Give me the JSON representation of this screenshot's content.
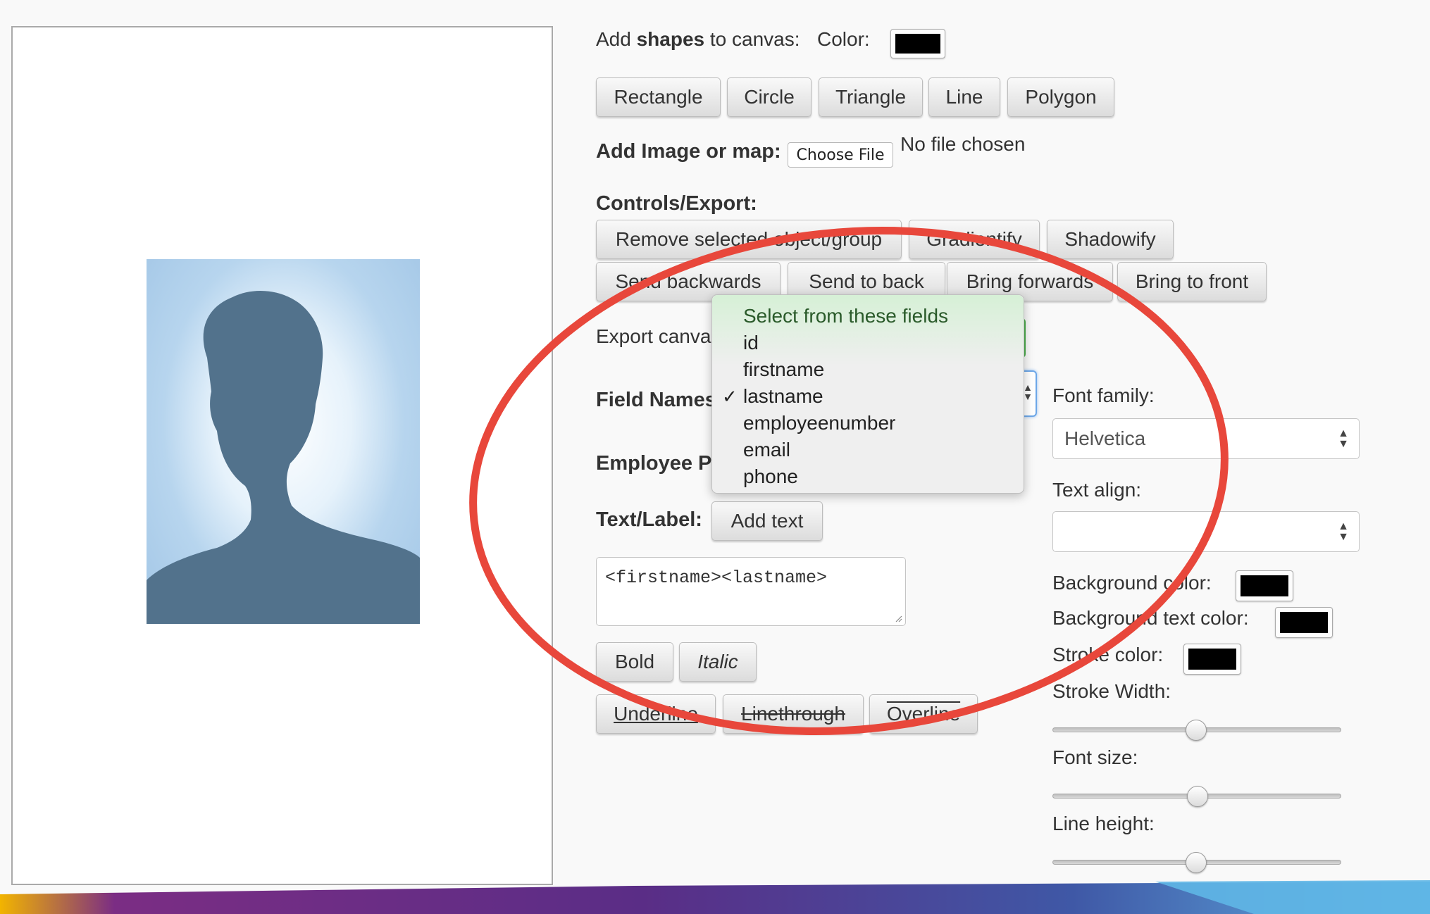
{
  "shapes": {
    "label_prefix": "Add ",
    "label_bold": "shapes",
    "label_suffix": " to canvas:",
    "color_label": "Color:",
    "color_value": "#000000",
    "buttons": [
      "Rectangle",
      "Circle",
      "Triangle",
      "Line",
      "Polygon"
    ]
  },
  "image": {
    "label": "Add Image or map:",
    "choose_file": "Choose File",
    "file_status": "No file chosen"
  },
  "controls": {
    "title": "Controls/Export:",
    "row1": [
      "Remove selected object/group",
      "Gradientify",
      "Shadowify"
    ],
    "row2": [
      "Send backwards",
      "Send to back",
      "Bring forwards",
      "Bring to front"
    ],
    "export_label": "Export canva"
  },
  "fields": {
    "field_names_label": "Field Names",
    "employee_pic_label": "Employee Pi",
    "dropdown": {
      "options": [
        "Select from these fields",
        "id",
        "firstname",
        "lastname",
        "employeenumber",
        "email",
        "phone"
      ],
      "selected": "lastname",
      "check": "✓"
    }
  },
  "text": {
    "label": "Text/Label:",
    "add_text": "Add text",
    "textarea_value": "<firstname><lastname>",
    "style_buttons": {
      "bold": "Bold",
      "italic": "Italic",
      "underline": "Underline",
      "linethrough": "Linethrough",
      "overline": "Overline"
    }
  },
  "right_panel": {
    "font_family_label": "Font family:",
    "font_family_value": "Helvetica",
    "text_align_label": "Text align:",
    "text_align_value": "",
    "bg_color_label": "Background color:",
    "bg_text_color_label": "Background text color:",
    "stroke_color_label": "Stroke color:",
    "stroke_width_label": "Stroke Width:",
    "font_size_label": "Font size:",
    "line_height_label": "Line height:",
    "colors": {
      "background": "#000000",
      "background_text": "#000000",
      "stroke": "#000000"
    },
    "sliders": {
      "stroke_width": 0.5,
      "font_size": 0.5,
      "line_height": 0.5
    }
  },
  "annotation": {
    "color": "#e8473b"
  }
}
